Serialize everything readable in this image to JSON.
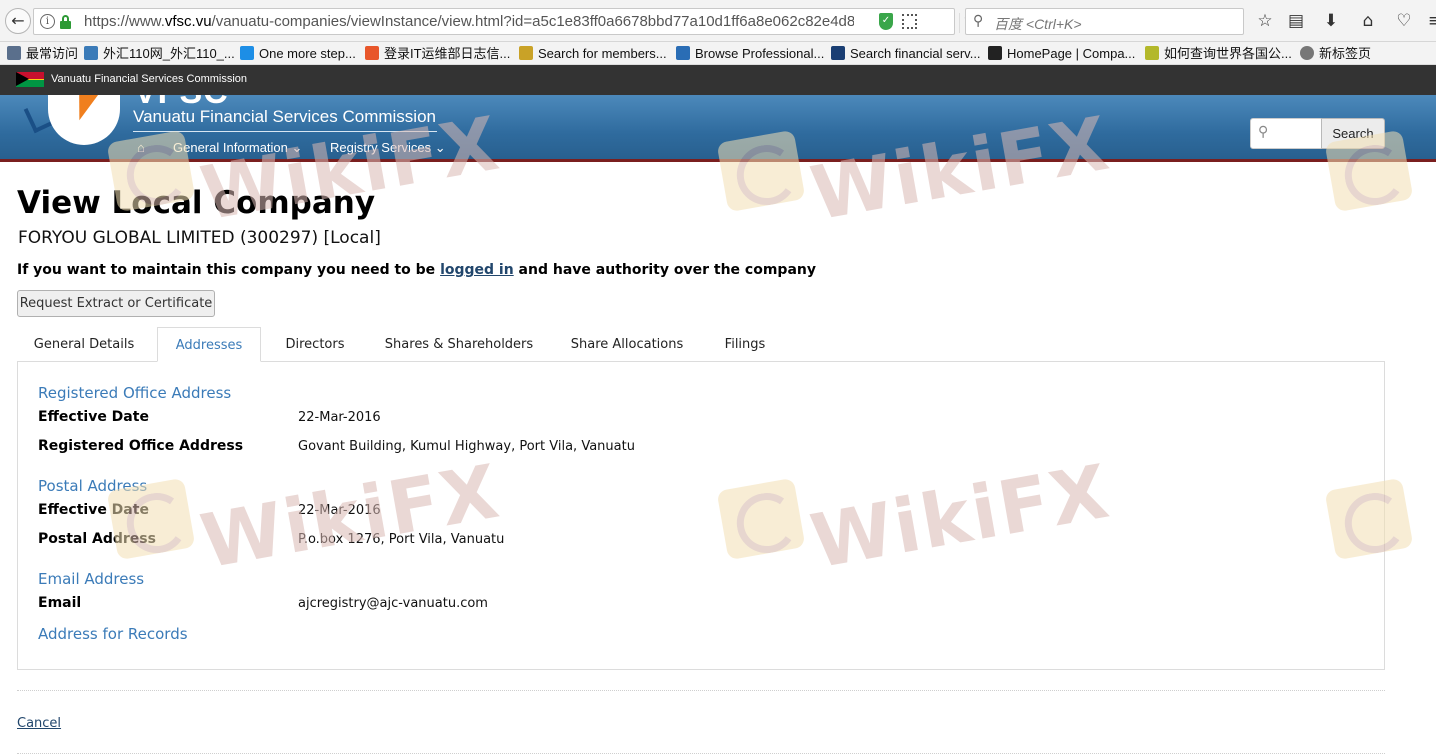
{
  "browser": {
    "url_scheme_part": "https://www.",
    "url_host": "vfsc.vu",
    "url_path": "/vanuatu-companies/viewInstance/view.html?id=a5c1e83ff0a6678bbd77a10d1ff6a8e062c82e4d8",
    "search_placeholder": "百度 <Ctrl+K>",
    "bookmarks": [
      "最常访问",
      "外汇110网_外汇110_...",
      "One more step...",
      "登录IT运维部日志信...",
      "Search for members...",
      "Browse Professional...",
      "Search financial serv...",
      "HomePage | Compa...",
      "如何查询世界各国公...",
      "新标签页"
    ],
    "bookmark_colors": [
      "#5a6f8c",
      "#3b7bb8",
      "#1d8ee6",
      "#e8562a",
      "#c9a227",
      "#2a6db5",
      "#1a3e73",
      "#222222",
      "#b3b82a",
      "#777777"
    ]
  },
  "site": {
    "strip_title": "Vanuatu Financial Services Commission",
    "logo_letters": "VFSC",
    "name": "Vanuatu Financial Services Commission",
    "nav": {
      "home_icon": "⌂",
      "general_information": "General Information ⌄",
      "registry_services": "Registry Services ⌄"
    },
    "search_button": "Search"
  },
  "page": {
    "title": "View Local Company",
    "company": "FORYOU GLOBAL LIMITED (300297) [Local]",
    "maintain_before": "If you want to maintain this company you need to be ",
    "maintain_link": "logged in",
    "maintain_after": " and have authority over the company",
    "request_button": "Request Extract or Certificate",
    "tabs": [
      "General Details",
      "Addresses",
      "Directors",
      "Shares & Shareholders",
      "Share Allocations",
      "Filings"
    ],
    "active_tab": "Addresses",
    "cancel": "Cancel"
  },
  "addresses": {
    "registered": {
      "heading": "Registered Office Address",
      "effective_label": "Effective Date",
      "effective_value": "22-Mar-2016",
      "address_label": "Registered Office Address",
      "address_value": "Govant Building, Kumul Highway, Port Vila, Vanuatu"
    },
    "postal": {
      "heading": "Postal Address",
      "effective_label": "Effective Date",
      "effective_value": "22-Mar-2016",
      "address_label": "Postal Address",
      "address_value": "P.o.box 1276, Port Vila, Vanuatu"
    },
    "email": {
      "heading": "Email Address",
      "label": "Email",
      "value": "ajcregistry@ajc-vanuatu.com"
    },
    "records": {
      "heading": "Address for Records"
    }
  },
  "watermark": {
    "text": "WikiFX"
  }
}
